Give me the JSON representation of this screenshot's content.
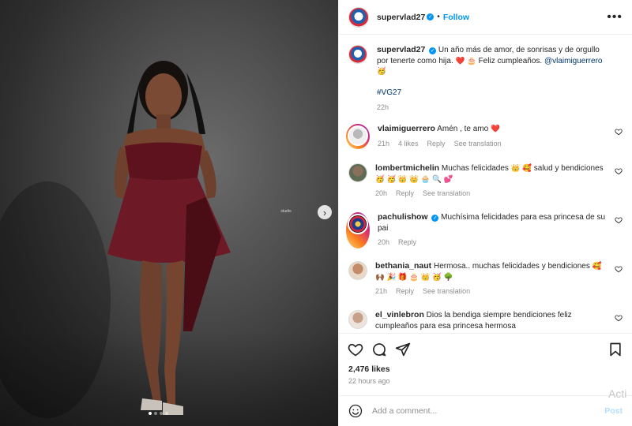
{
  "header": {
    "username": "supervlad27",
    "verified_glyph": "✓",
    "separator": "•",
    "follow_label": "Follow",
    "more_glyph": "•••"
  },
  "media": {
    "next_glyph": "›",
    "watermark": "studio",
    "slide_count": 4,
    "active_slide": 1
  },
  "caption": {
    "username": "supervlad27",
    "text_1": "Un año más de amor, de sonrisas y de orgullo por tenerte como hija.",
    "emojis_1": "❤️ 🎂",
    "text_2": "Feliz cumpleaños.",
    "mention": "@vlaimiguerrero",
    "emojis_2": "🥳",
    "hashtag": "#VG27",
    "time": "22h"
  },
  "comments": [
    {
      "username": "vlaimiguerrero",
      "text": "Amén , te amo",
      "emojis": "❤️",
      "time": "21h",
      "likes": "4 likes",
      "reply": "Reply",
      "translate": "See translation"
    },
    {
      "username": "lombertmichelin",
      "text": "Muchas felicidades",
      "emojis_a": "👑 🥰",
      "text_b": "salud y bendiciones",
      "emojis_b": "🥳 🥳 👑 👑 🧁 🔍 💕",
      "time": "20h",
      "reply": "Reply",
      "translate": "See translation"
    },
    {
      "username": "pachulishow",
      "text": "Muchísima felicidades para esa princesa de su pai",
      "time": "20h",
      "reply": "Reply"
    },
    {
      "username": "bethania_naut",
      "text": "Hermosa.. muchas felicidades y bendiciones",
      "emojis": "🥰",
      "emojis_b": "🙌🏾 🎉 🎁 🎂 👑 🥳 🌳",
      "time": "21h",
      "reply": "Reply",
      "translate": "See translation"
    },
    {
      "username": "el_vinlebron",
      "text": "Dios la bendiga siempre bendiciones feliz cumpleaños para esa princesa hermosa"
    }
  ],
  "stats": {
    "likes": "2,476 likes",
    "time_ago": "22 hours ago"
  },
  "composer": {
    "placeholder": "Add a comment...",
    "post_label": "Post"
  },
  "overlay": {
    "activate": "Acti"
  },
  "colors": {
    "brand_blue": "#0095f6",
    "link_blue": "#00376b",
    "heart_red": "#ed4956",
    "muted": "#8e8e8e",
    "dress": "#6e1a26"
  },
  "icons": [
    "verified-badge-icon",
    "more-options-icon",
    "next-arrow-icon",
    "heart-icon",
    "comment-icon",
    "share-icon",
    "save-icon",
    "emoji-icon"
  ]
}
